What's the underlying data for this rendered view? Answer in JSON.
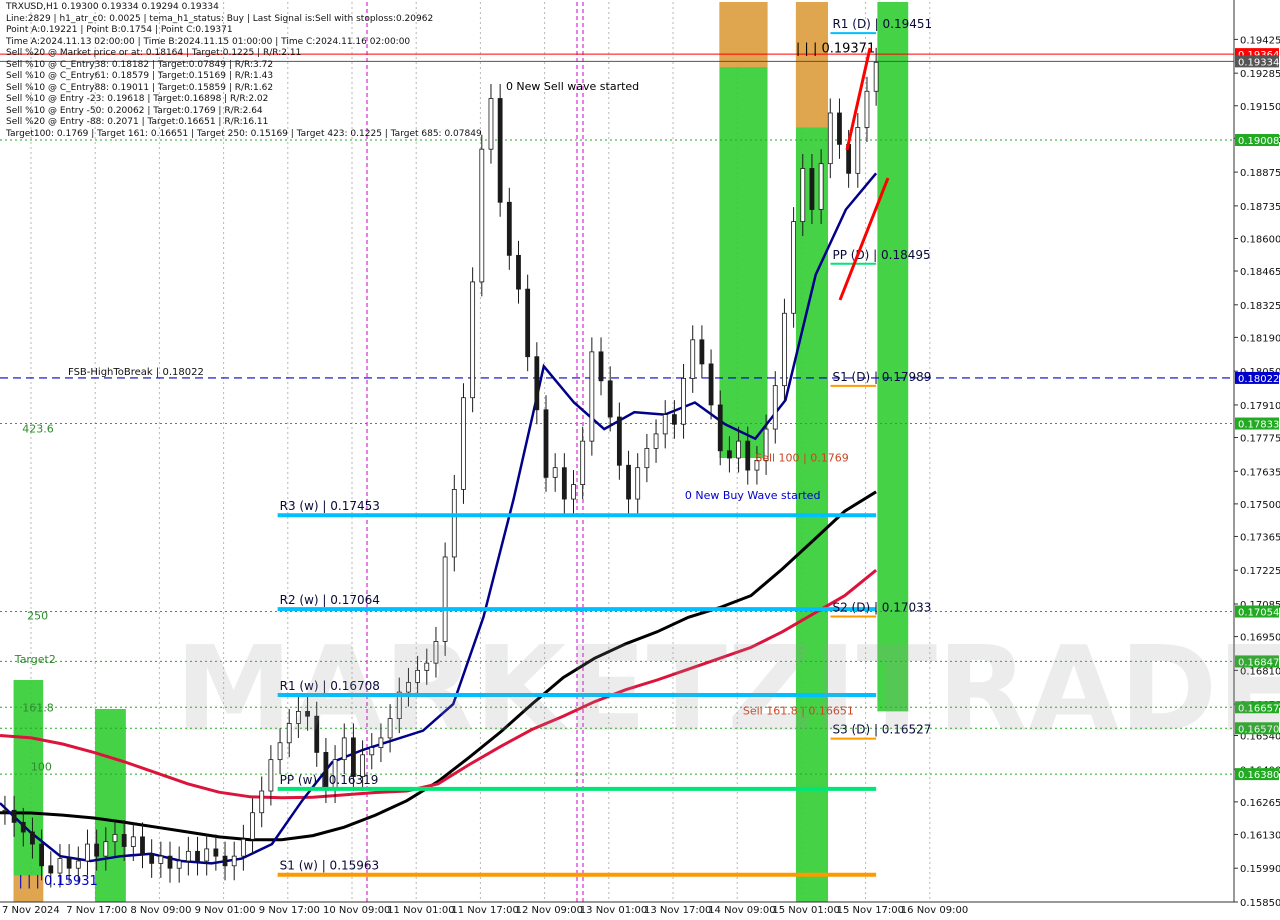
{
  "colors": {
    "background": "#ffffff",
    "bull_candle": "#1a1a1a",
    "bear_candle": "#1a1a1a",
    "tema_line": "#00008b",
    "ma_black": "#000000",
    "ma_red": "#dc143c",
    "pivot_weekly": "#00bfff",
    "pivot_daily_s": "#ff9900",
    "green_zone": "#32cd32",
    "orange_zone": "#f0a050",
    "fsb_line": "#0000cd",
    "red_arrow": "#ff0000",
    "blue_arrow": "#0000ff"
  },
  "info_panel": [
    "TRXUSD,H1  0.19300 0.19334 0.19294 0.19334",
    "Line:2829  |  h1_atr_c0: 0.0025  |  tema_h1_status: Buy  |  Last Signal is:Sell with stoploss:0.20962",
    "Point A:0.19221  |  Point B:0.1754  |  Point C:0.19371",
    "Time A:2024.11.13 02:00:00  |  Time B:2024.11.15 01:00:00  |  Time C:2024.11.16 02:00:00",
    "Sell %20 @ Market price or at: 0.18164  |  Target:0.1225  |  R/R:2.11",
    "Sell %10 @ C_Entry38: 0.18182  |  Target:0.07849  |  R/R:3.72",
    "Sell %10 @ C_Entry61: 0.18579  |  Target:0.15169  |  R/R:1.43",
    "Sell %10 @ C_Entry88: 0.19011  |  Target:0.15859  |  R/R:1.62",
    "Sell %10 @ Entry -23: 0.19618  |  Target:0.16898  |  R/R:2.02",
    "Sell %10 @ Entry -50: 0.20062  |  Target:0.1769  |  R/R:2.64",
    "Sell %20 @ Entry -88: 0.2071  |  Target:0.16651  |  R/R:16.11",
    "Target100: 0.1769  |  Target 161: 0.16651  |  Target 250: 0.15169  |  Target 423: 0.1225  |  Target 685: 0.07849"
  ],
  "chart_data": {
    "type": "candlestick",
    "symbol": "TRXUSD,H1",
    "ylim": [
      0.1585,
      0.1958
    ],
    "y_ticks": [
      0.19425,
      0.19285,
      0.1915,
      0.19015,
      0.18875,
      0.18735,
      0.186,
      0.18465,
      0.18325,
      0.1819,
      0.1805,
      0.1791,
      0.17775,
      0.17635,
      0.175,
      0.17365,
      0.17225,
      0.17085,
      0.1695,
      0.1681,
      0.1667,
      0.1654,
      0.164,
      0.16265,
      0.1613,
      0.1599,
      0.1585
    ],
    "y_tick_labels": [
      "0.19425",
      "0.19285",
      "0.19150",
      "0.19015",
      "0.18875",
      "0.18735",
      "0.18600",
      "0.18465",
      "0.18325",
      "0.18190",
      "0.18050",
      "0.17910",
      "0.17775",
      "0.17635",
      "0.17500",
      "0.17365",
      "0.17225",
      "0.17085",
      "0.16950",
      "0.16810",
      "0.16670",
      "0.16540",
      "0.16400",
      "0.16265",
      "0.16130",
      "0.15990",
      "0.15850"
    ],
    "x_labels": [
      "7 Nov 2024",
      "7 Nov 17:00",
      "8 Nov 09:00",
      "9 Nov 01:00",
      "9 Nov 17:00",
      "10 Nov 09:00",
      "11 Nov 01:00",
      "11 Nov 17:00",
      "12 Nov 09:00",
      "13 Nov 01:00",
      "13 Nov 17:00",
      "14 Nov 09:00",
      "15 Nov 01:00",
      "15 Nov 17:00",
      "16 Nov 09:00"
    ],
    "price_badges": [
      {
        "label": "0.19364",
        "value": 0.19364,
        "color": "#ff0000",
        "text_color": "#ffffff"
      },
      {
        "label": "0.19334",
        "value": 0.19334,
        "color": "#555555",
        "text_color": "#ffffff"
      },
      {
        "label": "0.19008",
        "value": 0.19008,
        "color": "#22aa22",
        "text_color": "#ffffff"
      },
      {
        "label": "0.18022",
        "value": 0.18022,
        "color": "#0000cd",
        "text_color": "#ffffff"
      },
      {
        "label": "0.17833",
        "value": 0.17833,
        "color": "#22aa22",
        "text_color": "#ffffff"
      },
      {
        "label": "0.17054",
        "value": 0.17054,
        "color": "#22aa22",
        "text_color": "#ffffff"
      },
      {
        "label": "0.16847",
        "value": 0.16847,
        "color": "#22aa22",
        "text_color": "#ffffff"
      },
      {
        "label": "0.16657",
        "value": 0.16657,
        "color": "#22aa22",
        "text_color": "#ffffff"
      },
      {
        "label": "0.16570",
        "value": 0.1657,
        "color": "#22aa22",
        "text_color": "#ffffff"
      },
      {
        "label": "0.16380",
        "value": 0.1638,
        "color": "#22aa22",
        "text_color": "#ffffff"
      }
    ],
    "horizontal_levels": [
      {
        "label": "R3 (w) | 0.17453",
        "value": 0.17453,
        "color": "#00bfff",
        "from": 0.225,
        "to": 0.71,
        "width": 4
      },
      {
        "label": "R2 (w) | 0.17064",
        "value": 0.17064,
        "color": "#00bfff",
        "from": 0.225,
        "to": 0.71,
        "width": 4
      },
      {
        "label": "R1 (w) | 0.16708",
        "value": 0.16708,
        "color": "#00bfff",
        "from": 0.225,
        "to": 0.71,
        "width": 4
      },
      {
        "label": "PP (w) | 0.16319",
        "value": 0.16319,
        "color": "#00e676",
        "from": 0.225,
        "to": 0.71,
        "width": 4
      },
      {
        "label": "S1 (w) | 0.15963",
        "value": 0.15963,
        "color": "#ff9900",
        "from": 0.225,
        "to": 0.71,
        "width": 4
      },
      {
        "label": "R1 (D) | 0.19451",
        "value": 0.19451,
        "color": "#00bfff",
        "from": 0.673,
        "to": 0.71,
        "width": 2
      },
      {
        "label": "PP (D) | 0.18495",
        "value": 0.18495,
        "color": "#00e676",
        "from": 0.673,
        "to": 0.71,
        "width": 2
      },
      {
        "label": "S1 (D) | 0.17989",
        "value": 0.17989,
        "color": "#ff9900",
        "from": 0.673,
        "to": 0.71,
        "width": 2
      },
      {
        "label": "S2 (D) | 0.17033",
        "value": 0.17033,
        "color": "#ff9900",
        "from": 0.673,
        "to": 0.71,
        "width": 2
      },
      {
        "label": "S3 (D) | 0.16527",
        "value": 0.16527,
        "color": "#ff9900",
        "from": 0.673,
        "to": 0.71,
        "width": 2
      }
    ],
    "dotted_levels": [
      {
        "value": 0.19364,
        "color": "#ff0000",
        "style": "solid"
      },
      {
        "value": 0.19334,
        "color": "#555555",
        "style": "solid"
      },
      {
        "value": 0.19008,
        "color": "#22aa22",
        "style": "dotted"
      },
      {
        "value": 0.17833,
        "color": "#22aa22",
        "style": "dotted"
      },
      {
        "value": 0.17054,
        "color": "#22aa22",
        "style": "dotted"
      },
      {
        "value": 0.16847,
        "color": "#22aa22",
        "style": "dotted"
      },
      {
        "value": 0.16657,
        "color": "#22aa22",
        "style": "dotted"
      },
      {
        "value": 0.1657,
        "color": "#22aa22",
        "style": "dotted"
      },
      {
        "value": 0.1638,
        "color": "#22aa22",
        "style": "dotted"
      }
    ],
    "fsb_line": {
      "label": "FSB-HighToBreak | 0.18022",
      "value": 0.18022
    },
    "annotations": [
      {
        "text": "0 New Sell wave started",
        "x": 0.41,
        "value": 0.19215,
        "color": "#000000"
      },
      {
        "text": "0 New Buy Wave started",
        "x": 0.555,
        "value": 0.1752,
        "color": "#0000cd"
      },
      {
        "text": "| | | 0.19371",
        "x": 0.645,
        "value": 0.19371,
        "color": "#000000",
        "size": 13
      },
      {
        "text": "| | | 0.15931",
        "x": 0.015,
        "value": 0.1592,
        "color": "#0000cd",
        "size": 13
      },
      {
        "text": "Sell 100 | 0.1769",
        "x": 0.612,
        "value": 0.17675,
        "color": "#cc4422"
      },
      {
        "text": "Sell 161.8 | 0.16651",
        "x": 0.602,
        "value": 0.16628,
        "color": "#cc4422"
      },
      {
        "text": "423.6",
        "x": 0.018,
        "value": 0.17795,
        "color": "#2e8b2e"
      },
      {
        "text": "250",
        "x": 0.022,
        "value": 0.1702,
        "color": "#2e8b2e"
      },
      {
        "text": "Target2",
        "x": 0.012,
        "value": 0.1684,
        "color": "#2e8b2e"
      },
      {
        "text": "161.8",
        "x": 0.018,
        "value": 0.1664,
        "color": "#2e8b2e"
      },
      {
        "text": "100",
        "x": 0.025,
        "value": 0.16395,
        "color": "#2e8b2e"
      }
    ],
    "series": [
      {
        "name": "",
        "color": "#000000",
        "values": [
          0.1622,
          0.16219,
          0.1621,
          0.16198,
          0.1618,
          0.1616,
          0.1614,
          0.1612,
          0.16108,
          0.16108,
          0.16125,
          0.1616,
          0.1621,
          0.1627,
          0.1635,
          0.1645,
          0.16555,
          0.1667,
          0.1678,
          0.1686,
          0.1692,
          0.1697,
          0.1703,
          0.1707,
          0.1712,
          0.1723,
          0.1735,
          0.1747,
          0.1755
        ]
      },
      {
        "name": "",
        "color": "#dc143c",
        "values": [
          0.1654,
          0.1653,
          0.16505,
          0.1647,
          0.1643,
          0.16385,
          0.1634,
          0.16305,
          0.16286,
          0.16282,
          0.16284,
          0.16294,
          0.16304,
          0.1631,
          0.1634,
          0.1642,
          0.16495,
          0.16565,
          0.1662,
          0.1668,
          0.1673,
          0.1677,
          0.16815,
          0.1686,
          0.16905,
          0.1697,
          0.17045,
          0.1712,
          0.17225
        ]
      },
      {
        "name": "",
        "color": "#00008b",
        "values": [
          0.1626,
          0.1614,
          0.1604,
          0.1602,
          0.1604,
          0.1605,
          0.1602,
          0.1601,
          0.1603,
          0.1609,
          0.1627,
          0.1643,
          0.1648,
          0.1652,
          0.1656,
          0.1667,
          0.1703,
          0.1752,
          0.1807,
          0.1792,
          0.1781,
          0.1788,
          0.1787,
          0.1792,
          0.1783,
          0.1777,
          0.1793,
          0.1845,
          0.1872,
          0.1887
        ]
      }
    ],
    "zones": [
      {
        "x0": 0.011,
        "x1": 0.035,
        "y0": 0.1585,
        "y1": 0.1677,
        "color": "#32cd32"
      },
      {
        "x0": 0.011,
        "x1": 0.035,
        "y0": 0.1585,
        "y1": 0.1596,
        "color": "#f0a050"
      },
      {
        "x0": 0.077,
        "x1": 0.102,
        "y0": 0.1585,
        "y1": 0.1665,
        "color": "#32cd32"
      },
      {
        "x0": 0.583,
        "x1": 0.622,
        "y0": 0.1769,
        "y1": 0.1958,
        "color": "#32cd32"
      },
      {
        "x0": 0.583,
        "x1": 0.622,
        "y0": 0.1931,
        "y1": 0.1958,
        "color": "#f0a050"
      },
      {
        "x0": 0.645,
        "x1": 0.671,
        "y0": 0.1585,
        "y1": 0.1958,
        "color": "#32cd32"
      },
      {
        "x0": 0.645,
        "x1": 0.671,
        "y0": 0.1906,
        "y1": 0.1958,
        "color": "#f0a050"
      },
      {
        "x0": 0.711,
        "x1": 0.736,
        "y0": 0.1664,
        "y1": 0.1958,
        "color": "#32cd32"
      }
    ],
    "candles": [
      0.1623,
      0.1618,
      0.1614,
      0.1609,
      0.16,
      0.1597,
      0.1603,
      0.1599,
      0.1602,
      0.1609,
      0.1604,
      0.161,
      0.1613,
      0.1608,
      0.1612,
      0.1605,
      0.1601,
      0.1604,
      0.1599,
      0.1602,
      0.1606,
      0.1602,
      0.1607,
      0.1604,
      0.16,
      0.1604,
      0.1611,
      0.1622,
      0.1631,
      0.1644,
      0.1651,
      0.1659,
      0.1664,
      0.1662,
      0.1647,
      0.1632,
      0.1644,
      0.1653,
      0.1637,
      0.1646,
      0.1649,
      0.1653,
      0.1661,
      0.1672,
      0.1676,
      0.1681,
      0.1684,
      0.1693,
      0.1728,
      0.1756,
      0.1794,
      0.1842,
      0.1897,
      0.1918,
      0.1875,
      0.1853,
      0.1839,
      0.1811,
      0.1789,
      0.1761,
      0.1765,
      0.1752,
      0.1758,
      0.1776,
      0.1813,
      0.1801,
      0.1786,
      0.1766,
      0.1752,
      0.1765,
      0.1773,
      0.1779,
      0.1787,
      0.1783,
      0.1802,
      0.1818,
      0.1808,
      0.1791,
      0.1772,
      0.1769,
      0.1776,
      0.1764,
      0.1768,
      0.1781,
      0.1799,
      0.1829,
      0.1867,
      0.1889,
      0.1872,
      0.1891,
      0.1912,
      0.1899,
      0.1887,
      0.1906,
      0.1921,
      0.1933
    ]
  }
}
